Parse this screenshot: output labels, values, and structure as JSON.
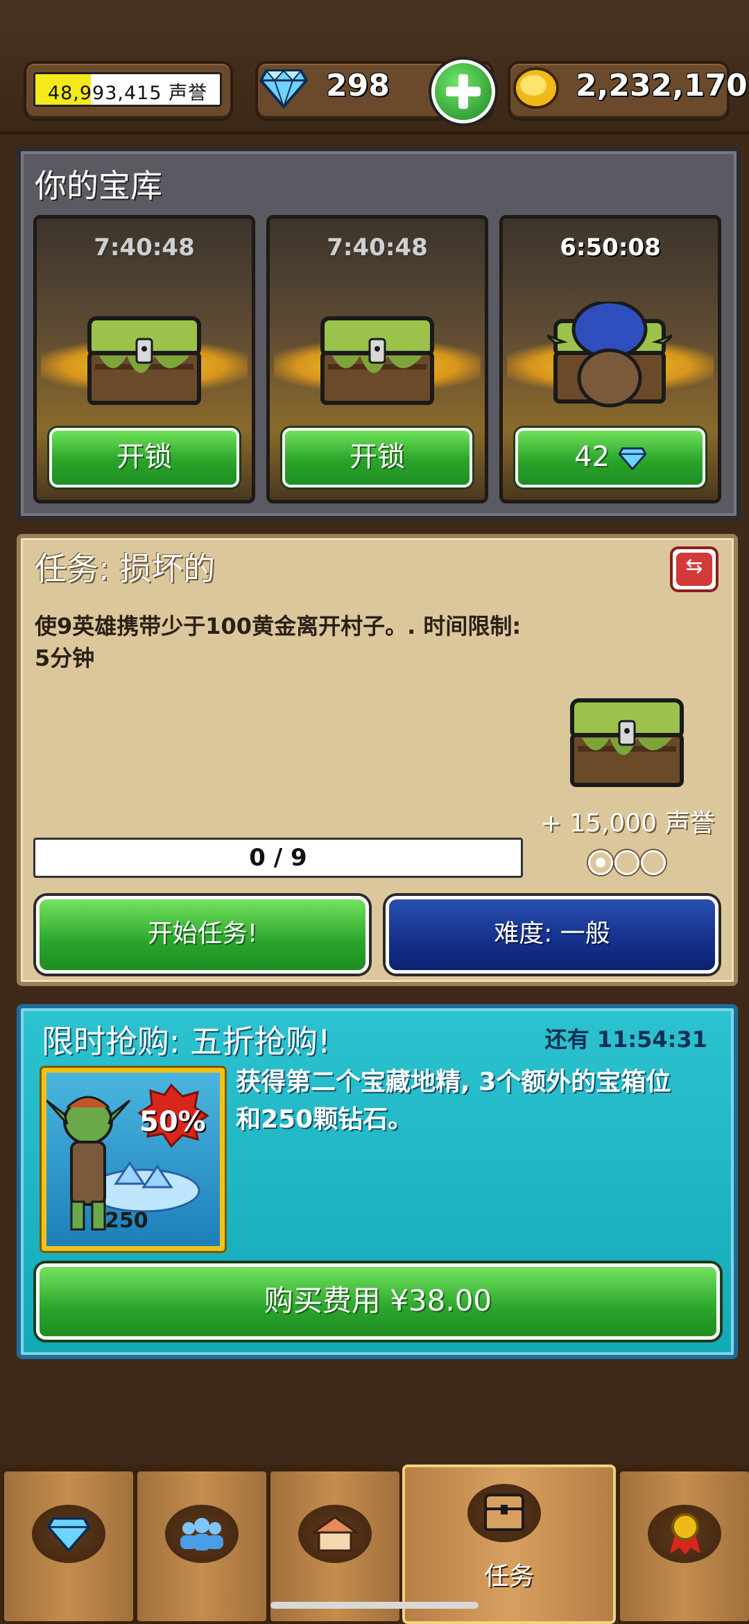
{
  "top_bar": {
    "reputation_text": "48,993,415 声誉",
    "reputation_fill": 0.3,
    "gems": "298",
    "gold": "2,232,170",
    "icons": {
      "gem": "diamond-icon",
      "plus": "plus-icon",
      "gold": "gold-coin-icon"
    }
  },
  "vault": {
    "title": "你的宝库",
    "slots": [
      {
        "timer": "7:40:48",
        "button": "开锁"
      },
      {
        "timer": "7:40:48",
        "button": "开锁"
      },
      {
        "timer": "6:50:08",
        "button": "42",
        "button_icon": "diamond-icon"
      }
    ]
  },
  "mission": {
    "title": "任务: 损坏的",
    "description": "使9英雄携带少于100黄金离开村子。. 时间限制: 5分钟",
    "reward": "+ 15,000 声誉",
    "difficulty_level": 1,
    "difficulty_max": 3,
    "progress_text": "0 / 9",
    "progress_value": 0,
    "start_button": "开始任务!",
    "difficulty_button": "难度: 一般"
  },
  "sale": {
    "title": "限时抢购: 五折抢购!",
    "timer": "还有 11:54:31",
    "description": "获得第二个宝藏地精, 3个额外的宝箱位和250颗钻石。",
    "badge": "50%",
    "image_count": "250",
    "buy_button": "购买费用 ¥38.00"
  },
  "nav": {
    "tabs": [
      {
        "icon": "diamond-icon"
      },
      {
        "icon": "heroes-icon"
      },
      {
        "icon": "village-icon"
      },
      {
        "icon": "chest-icon",
        "label": "任务",
        "active": true
      },
      {
        "icon": "medal-icon"
      }
    ]
  },
  "colors": {
    "green_button": "#2aa52b",
    "blue_button": "#13308a",
    "sale_panel": "#13a9b8",
    "mission_panel": "#dcc79c"
  }
}
